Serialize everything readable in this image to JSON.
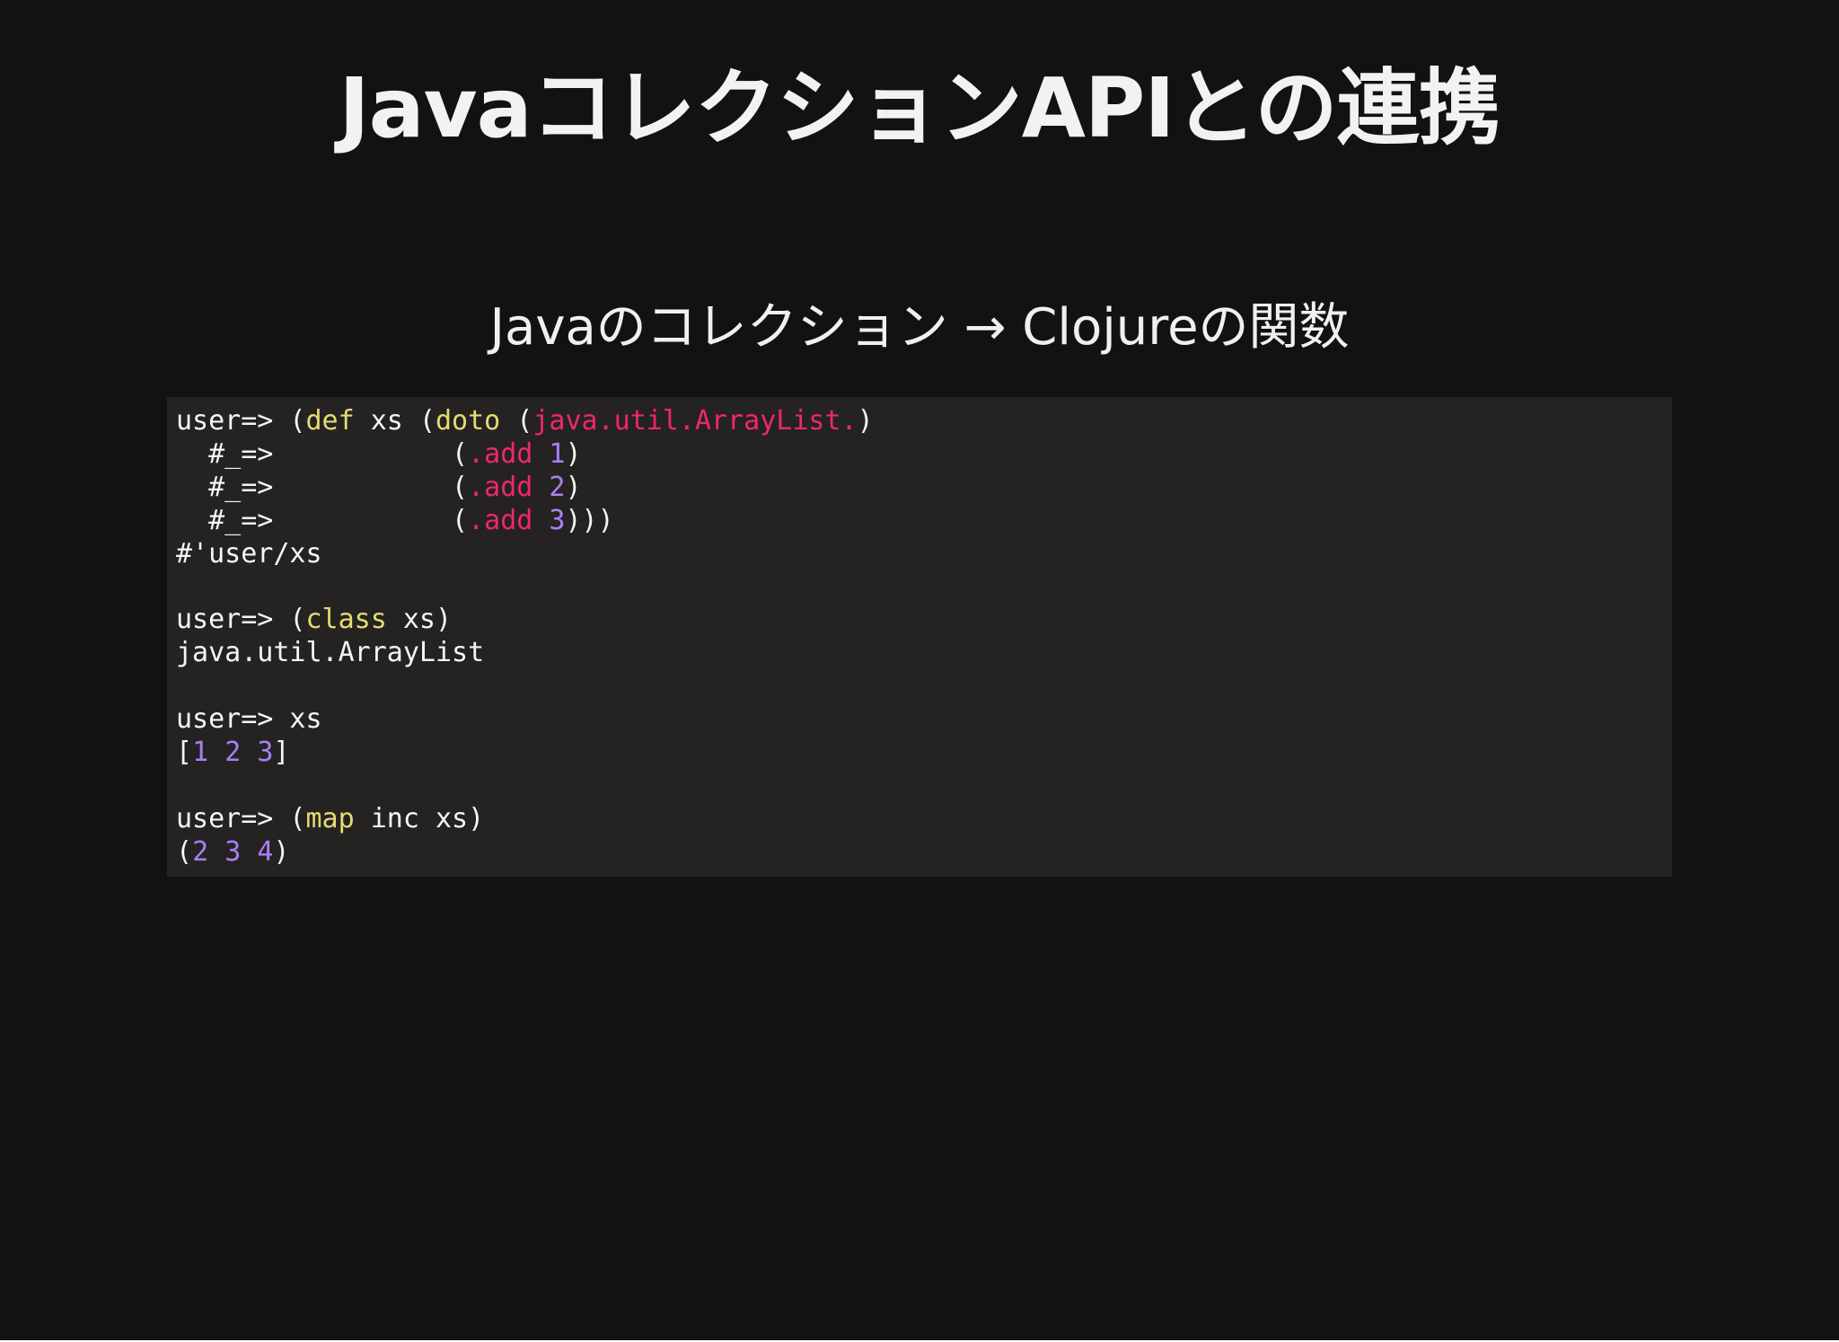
{
  "slide": {
    "title": "JavaコレクションAPIとの連携",
    "subtitle": "Javaのコレクション → Clojureの関数"
  },
  "colors": {
    "background": "#121212",
    "code_background": "#252322",
    "function_keyword": "#e6db74",
    "java_interop": "#f0266f",
    "number_literal": "#ab7ff5",
    "text": "#f5f5f5"
  },
  "code": {
    "lines": [
      [
        {
          "text": "user=> (",
          "kind": "plain"
        },
        {
          "text": "def",
          "kind": "fn"
        },
        {
          "text": " xs (",
          "kind": "plain"
        },
        {
          "text": "doto",
          "kind": "fn"
        },
        {
          "text": " (",
          "kind": "plain"
        },
        {
          "text": "java.util.ArrayList.",
          "kind": "java"
        },
        {
          "text": ")",
          "kind": "plain"
        }
      ],
      [
        {
          "text": "  #_=>           (",
          "kind": "plain"
        },
        {
          "text": ".add",
          "kind": "java"
        },
        {
          "text": " ",
          "kind": "plain"
        },
        {
          "text": "1",
          "kind": "num"
        },
        {
          "text": ")",
          "kind": "plain"
        }
      ],
      [
        {
          "text": "  #_=>           (",
          "kind": "plain"
        },
        {
          "text": ".add",
          "kind": "java"
        },
        {
          "text": " ",
          "kind": "plain"
        },
        {
          "text": "2",
          "kind": "num"
        },
        {
          "text": ")",
          "kind": "plain"
        }
      ],
      [
        {
          "text": "  #_=>           (",
          "kind": "plain"
        },
        {
          "text": ".add",
          "kind": "java"
        },
        {
          "text": " ",
          "kind": "plain"
        },
        {
          "text": "3",
          "kind": "num"
        },
        {
          "text": ")))",
          "kind": "plain"
        }
      ],
      [
        {
          "text": "#'user/xs",
          "kind": "plain"
        }
      ],
      [],
      [
        {
          "text": "user=> (",
          "kind": "plain"
        },
        {
          "text": "class",
          "kind": "fn"
        },
        {
          "text": " xs)",
          "kind": "plain"
        }
      ],
      [
        {
          "text": "java.util.ArrayList",
          "kind": "plain"
        }
      ],
      [],
      [
        {
          "text": "user=> xs",
          "kind": "plain"
        }
      ],
      [
        {
          "text": "[",
          "kind": "plain"
        },
        {
          "text": "1",
          "kind": "num"
        },
        {
          "text": " ",
          "kind": "plain"
        },
        {
          "text": "2",
          "kind": "num"
        },
        {
          "text": " ",
          "kind": "plain"
        },
        {
          "text": "3",
          "kind": "num"
        },
        {
          "text": "]",
          "kind": "plain"
        }
      ],
      [],
      [
        {
          "text": "user=> (",
          "kind": "plain"
        },
        {
          "text": "map",
          "kind": "fn"
        },
        {
          "text": " inc xs)",
          "kind": "plain"
        }
      ],
      [
        {
          "text": "(",
          "kind": "plain"
        },
        {
          "text": "2",
          "kind": "num"
        },
        {
          "text": " ",
          "kind": "plain"
        },
        {
          "text": "3",
          "kind": "num"
        },
        {
          "text": " ",
          "kind": "plain"
        },
        {
          "text": "4",
          "kind": "num"
        },
        {
          "text": ")",
          "kind": "plain"
        }
      ]
    ]
  }
}
